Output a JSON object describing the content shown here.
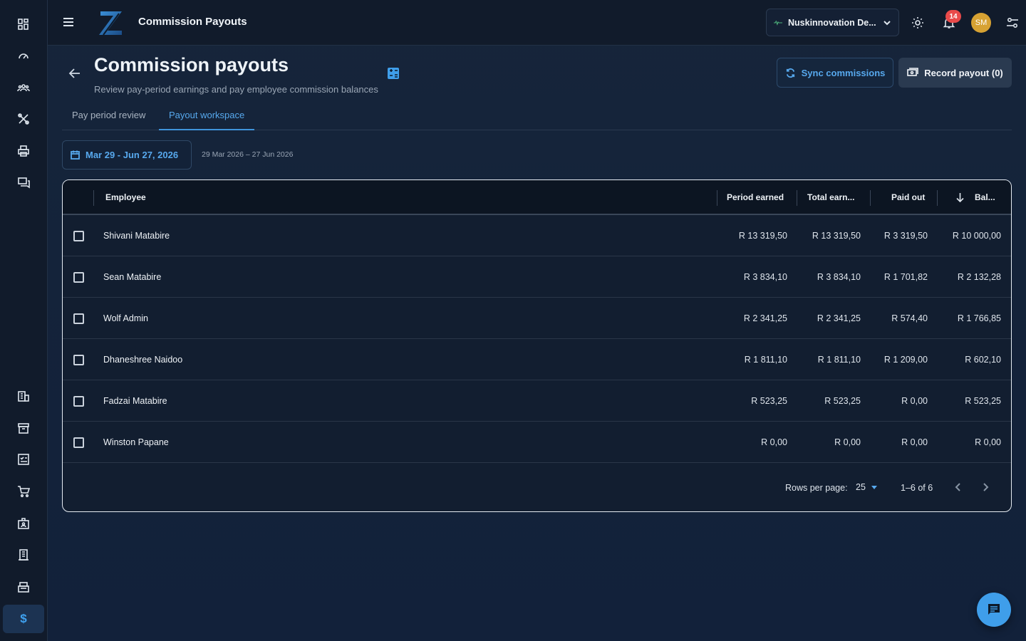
{
  "topbar": {
    "app_title": "Commission Payouts",
    "org_name": "Nuskinnovation De...",
    "notifications_count": "14",
    "avatar_initials": "SM"
  },
  "header": {
    "title": "Commission payouts",
    "subtitle": "Review pay-period earnings and pay employee commission balances",
    "sync_label": "Sync commissions",
    "record_label": "Record payout (0)"
  },
  "tabs": [
    {
      "label": "Pay period review",
      "active": false
    },
    {
      "label": "Payout workspace",
      "active": true
    }
  ],
  "date_range": {
    "label": "Mar 29 - Jun 27, 2026",
    "caption": "29 Mar 2026 – 27 Jun 2026"
  },
  "table": {
    "columns": [
      "Employee",
      "Period earned",
      "Total earn...",
      "Paid out",
      "Bal..."
    ],
    "rows": [
      {
        "name": "Shivani Matabire",
        "period": "R 13 319,50",
        "total": "R 13 319,50",
        "paid": "R 3 319,50",
        "balance": "R 10 000,00"
      },
      {
        "name": "Sean Matabire",
        "period": "R 3 834,10",
        "total": "R 3 834,10",
        "paid": "R 1 701,82",
        "balance": "R 2 132,28"
      },
      {
        "name": "Wolf Admin",
        "period": "R 2 341,25",
        "total": "R 2 341,25",
        "paid": "R 574,40",
        "balance": "R 1 766,85"
      },
      {
        "name": "Dhaneshree Naidoo",
        "period": "R 1 811,10",
        "total": "R 1 811,10",
        "paid": "R 1 209,00",
        "balance": "R 602,10"
      },
      {
        "name": "Fadzai Matabire",
        "period": "R 523,25",
        "total": "R 523,25",
        "paid": "R 0,00",
        "balance": "R 523,25"
      },
      {
        "name": "Winston Papane",
        "period": "R 0,00",
        "total": "R 0,00",
        "paid": "R 0,00",
        "balance": "R 0,00"
      }
    ],
    "footer": {
      "rows_per_page_label": "Rows per page:",
      "rows_per_page": "25",
      "range": "1–6 of 6"
    }
  },
  "colors": {
    "accent": "#3f9eea",
    "sidebar_bg": "#111b2b",
    "badge": "#e94a4a",
    "avatar": "#d7a233"
  },
  "icons": {
    "sidebar": [
      "dashboard-icon",
      "gauge-icon",
      "people-icon",
      "tools-icon",
      "printer-icon",
      "chat-icon",
      "building-icon",
      "archive-icon",
      "checklist-icon",
      "cart-icon",
      "id-badge-icon",
      "receipt-icon",
      "register-icon",
      "dollar-icon"
    ]
  }
}
